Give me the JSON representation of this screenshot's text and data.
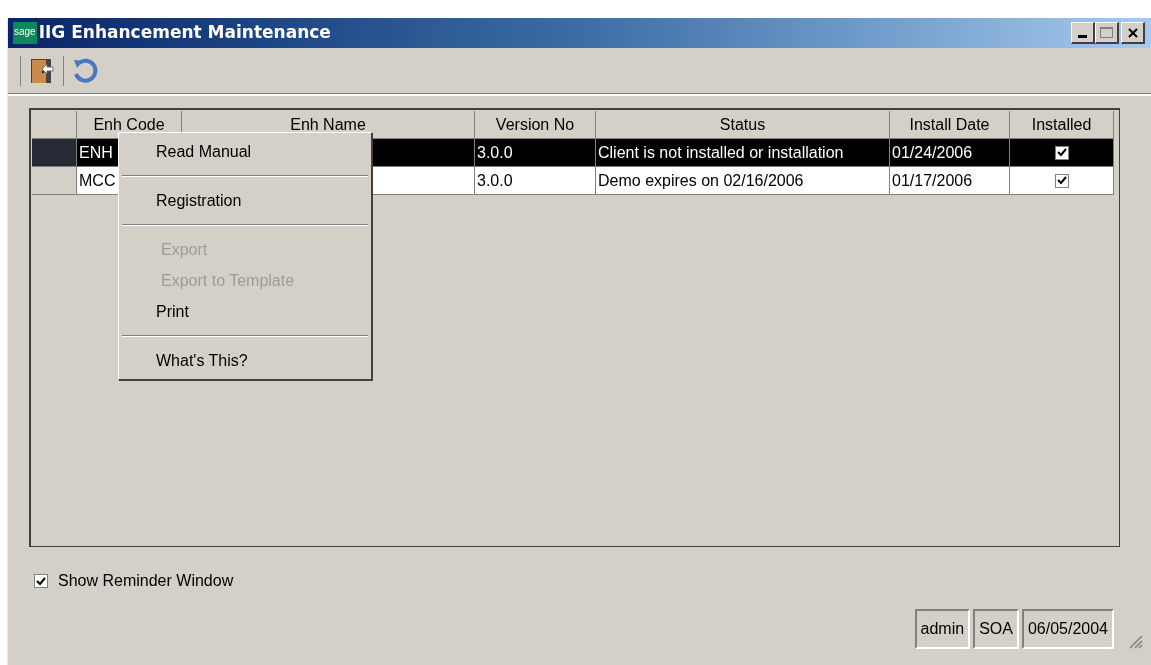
{
  "window": {
    "logo": "sage",
    "title": "IIG Enhancement Maintenance"
  },
  "table": {
    "columns": [
      "Enh Code",
      "Enh Name",
      "Version No",
      "Status",
      "Install Date",
      "Installed"
    ],
    "rows": [
      {
        "code": "ENH",
        "version": "3.0.0",
        "status": "Client is not installed or installation",
        "install_date": "01/24/2006",
        "installed": true,
        "selected": true
      },
      {
        "code": "MCC",
        "version": "3.0.0",
        "status": "Demo expires on 02/16/2006",
        "install_date": "01/17/2006",
        "installed": true,
        "selected": false
      }
    ]
  },
  "context_menu": [
    {
      "kind": "item",
      "label": "Read Manual",
      "disabled": false
    },
    {
      "kind": "separator"
    },
    {
      "kind": "item",
      "label": "Registration",
      "disabled": false
    },
    {
      "kind": "separator"
    },
    {
      "kind": "item",
      "label": "Export",
      "disabled": true
    },
    {
      "kind": "item",
      "label": "Export to Template",
      "disabled": true
    },
    {
      "kind": "item",
      "label": "Print",
      "disabled": false
    },
    {
      "kind": "separator"
    },
    {
      "kind": "item",
      "label": "What's This?",
      "disabled": false
    }
  ],
  "show_reminder": {
    "label": "Show Reminder Window",
    "checked": true
  },
  "status_bar": [
    "admin",
    "SOA",
    "06/05/2004"
  ]
}
